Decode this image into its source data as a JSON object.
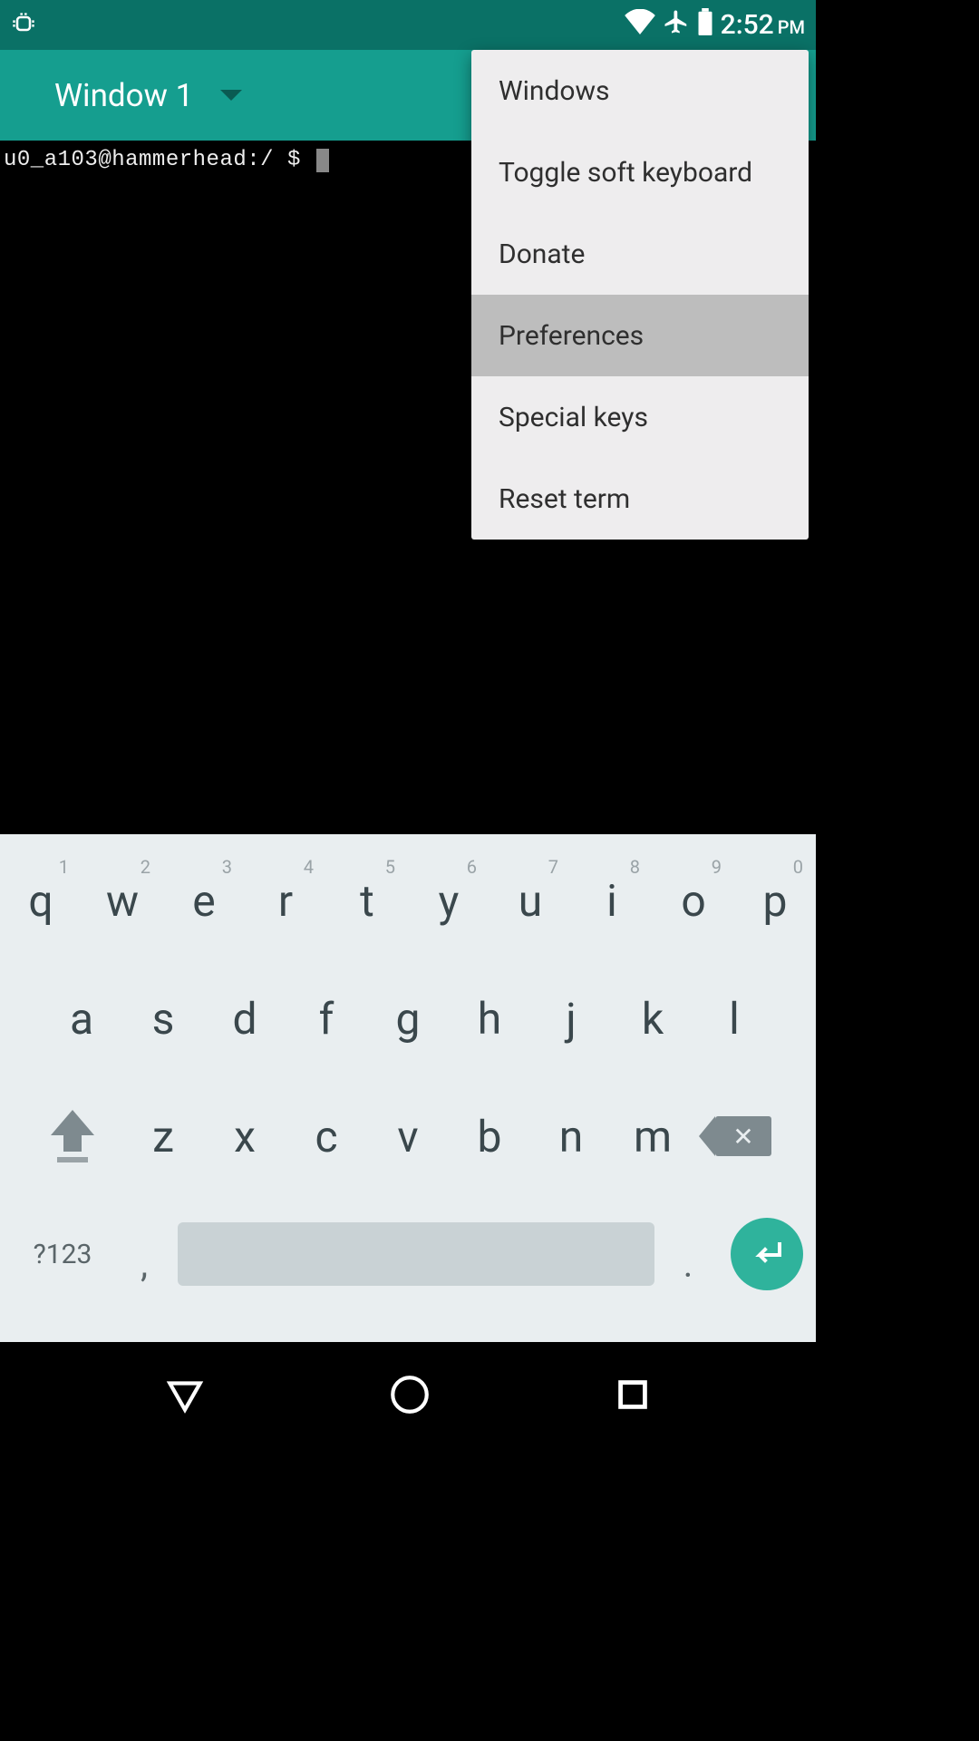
{
  "status": {
    "time": "2:52",
    "ampm": "PM"
  },
  "appbar": {
    "window_label": "Window 1"
  },
  "terminal": {
    "prompt": "u0_a103@hammerhead:/ $ "
  },
  "menu": {
    "items": [
      {
        "label": "Windows",
        "highlight": false
      },
      {
        "label": "Toggle soft keyboard",
        "highlight": false
      },
      {
        "label": "Donate",
        "highlight": false
      },
      {
        "label": "Preferences",
        "highlight": true
      },
      {
        "label": "Special keys",
        "highlight": false
      },
      {
        "label": "Reset term",
        "highlight": false
      }
    ]
  },
  "keyboard": {
    "row1": [
      {
        "k": "q",
        "h": "1"
      },
      {
        "k": "w",
        "h": "2"
      },
      {
        "k": "e",
        "h": "3"
      },
      {
        "k": "r",
        "h": "4"
      },
      {
        "k": "t",
        "h": "5"
      },
      {
        "k": "y",
        "h": "6"
      },
      {
        "k": "u",
        "h": "7"
      },
      {
        "k": "i",
        "h": "8"
      },
      {
        "k": "o",
        "h": "9"
      },
      {
        "k": "p",
        "h": "0"
      }
    ],
    "row2": [
      "a",
      "s",
      "d",
      "f",
      "g",
      "h",
      "j",
      "k",
      "l"
    ],
    "row3": [
      "z",
      "x",
      "c",
      "v",
      "b",
      "n",
      "m"
    ],
    "symbols_label": "?123",
    "comma": ",",
    "period": "."
  }
}
